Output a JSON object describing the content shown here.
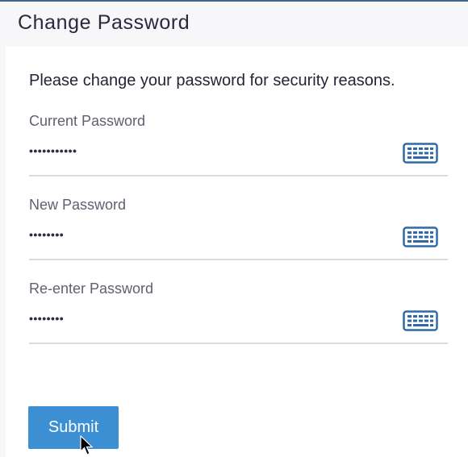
{
  "header": {
    "title": "Change Password"
  },
  "form": {
    "intro": "Please change your password for security reasons.",
    "fields": [
      {
        "label": "Current Password",
        "value": "•••••••••••",
        "icon": "keyboard-icon"
      },
      {
        "label": "New Password",
        "value": "••••••••",
        "icon": "keyboard-icon"
      },
      {
        "label": "Re-enter Password",
        "value": "••••••••",
        "icon": "keyboard-icon"
      }
    ],
    "submit_label": "Submit"
  },
  "colors": {
    "accent": "#3d8fd4",
    "icon": "#2e6aa8",
    "top_border": "#3f6688",
    "title_text": "#272a3c"
  }
}
